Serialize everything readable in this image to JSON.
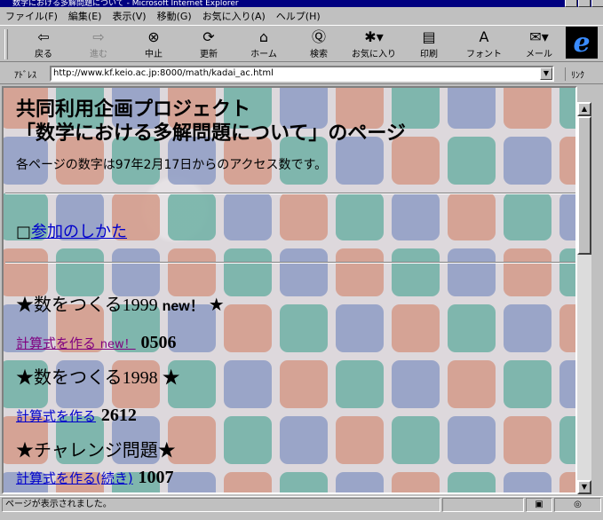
{
  "window": {
    "title": "数学における多解問題について - Microsoft Internet Explorer"
  },
  "menu": [
    "ファイル(F)",
    "編集(E)",
    "表示(V)",
    "移動(G)",
    "お気に入り(A)",
    "ヘルプ(H)"
  ],
  "toolbar": [
    {
      "label": "戻る",
      "icon": "back-arrow-icon"
    },
    {
      "label": "進む",
      "icon": "forward-arrow-icon"
    },
    {
      "label": "中止",
      "icon": "stop-icon"
    },
    {
      "label": "更新",
      "icon": "refresh-icon"
    },
    {
      "label": "ホーム",
      "icon": "home-icon"
    },
    {
      "label": "検索",
      "icon": "search-icon"
    },
    {
      "label": "お気に入り",
      "icon": "favorites-icon"
    },
    {
      "label": "印刷",
      "icon": "print-icon"
    },
    {
      "label": "フォント",
      "icon": "font-icon"
    },
    {
      "label": "メール",
      "icon": "mail-icon"
    }
  ],
  "address": {
    "label": "ｱﾄﾞﾚｽ",
    "url": "http://www.kf.keio.ac.jp:8000/math/kadai_ac.html",
    "links_label": "ﾘﾝｸ"
  },
  "page": {
    "title_line1": "共同利用企画プロジェクト",
    "title_line2": "「数学における多解問題について」のページ",
    "access_note": "各ページの数字は97年2月17日からのアクセス数です。",
    "join_bullet": "□",
    "join_link": "参加のしかた",
    "sections": [
      {
        "heading": "★数をつくる1999",
        "new_tag": "new！",
        "tail": "★",
        "link": "計算式を作る",
        "link_new": "new！",
        "count": "0506"
      },
      {
        "heading": "★数をつくる1998",
        "tail": "★",
        "link": "計算式を作る",
        "count": "2612"
      },
      {
        "heading": "★チャレンジ問題★",
        "link": "計算式を作る(続き)",
        "count": "1007"
      }
    ]
  },
  "status": {
    "message": "ページが表示されました。"
  },
  "colors": {
    "tile_red": "#d49a88",
    "tile_teal": "#6fb0a4",
    "tile_blue": "#8e9cc4",
    "link": "#0000cc",
    "visited": "#800080"
  }
}
